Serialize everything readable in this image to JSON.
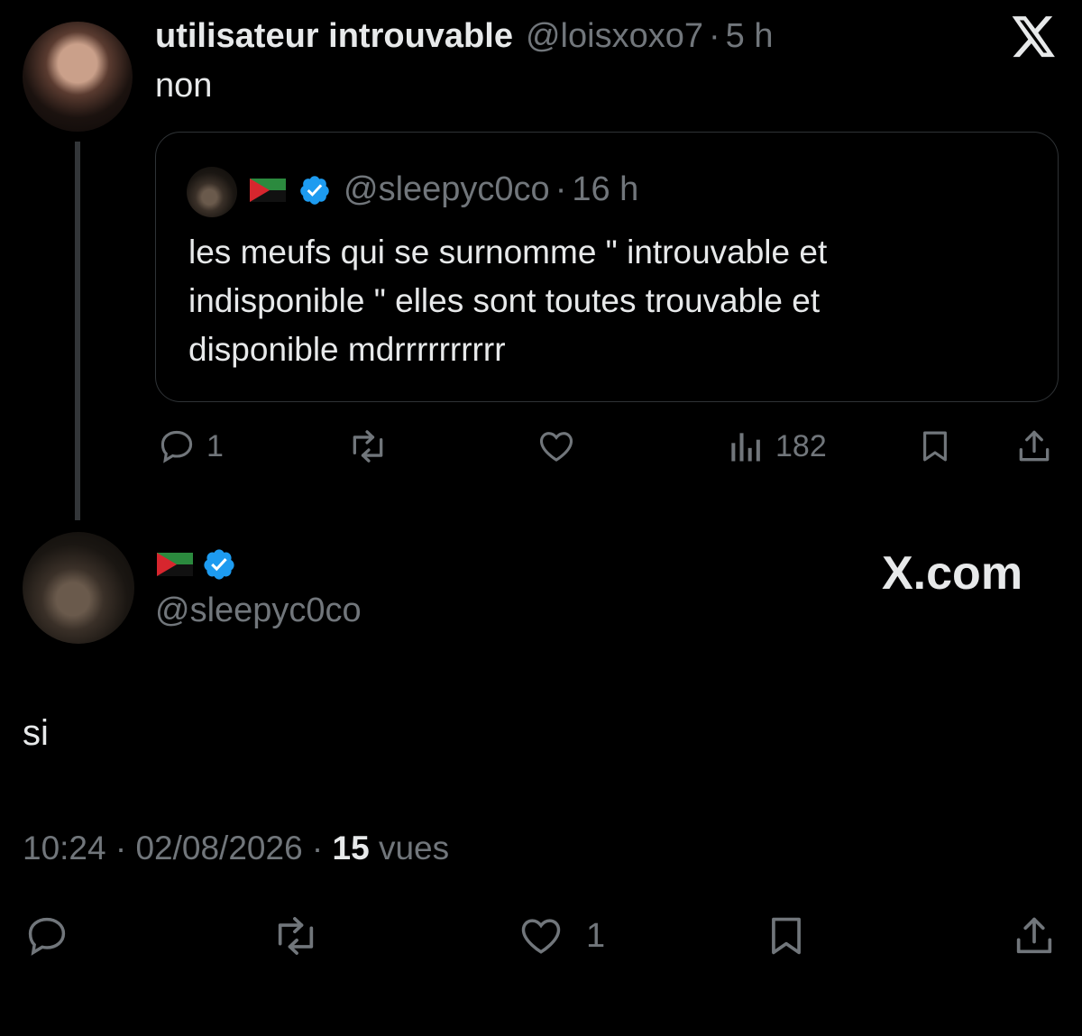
{
  "tweet1": {
    "author_name": "utilisateur introuvable",
    "handle": "@loisxoxo7",
    "time": "5 h",
    "text": "non",
    "quote": {
      "handle": "@sleepyc0co",
      "time": "16 h",
      "text_lines": [
        "les meufs qui se surnomme \" introuvable et",
        "indisponible \" elles sont toutes trouvable et",
        "disponible mdrrrrrrrrrr"
      ]
    },
    "actions": {
      "replies": "1",
      "views": "182"
    }
  },
  "brand": {
    "x_com": "X.com"
  },
  "tweet2": {
    "handle": "@sleepyc0co",
    "text": "si",
    "timestamp": "10:24 · 02/08/2026 ·",
    "views_count": "15",
    "views_label": "vues",
    "likes": "1"
  },
  "colors": {
    "background": "#000000",
    "text": "#e7e9ea",
    "muted": "#71767b",
    "verified": "#1d9bf0",
    "border": "#2f3336"
  },
  "icons": [
    "x-logo-icon",
    "verified-badge-icon",
    "flag-icon",
    "reply-icon",
    "retweet-icon",
    "like-icon",
    "views-icon",
    "bookmark-icon",
    "share-icon"
  ]
}
